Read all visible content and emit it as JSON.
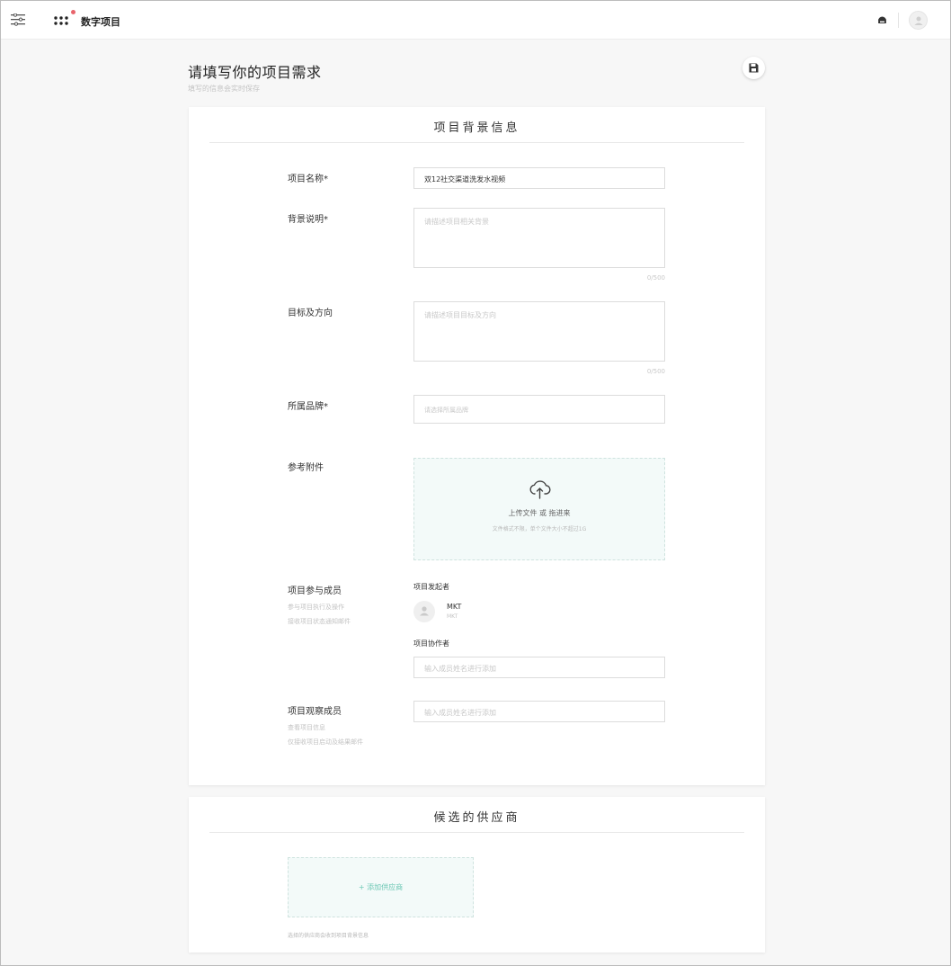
{
  "topbar": {
    "app_name": "数字项目",
    "icons": [
      "menu-icon",
      "apps-grid-icon",
      "notification-dot",
      "helmet-icon",
      "user-avatar-icon"
    ]
  },
  "header": {
    "title": "请填写你的项目需求",
    "subtitle": "填写的信息会实时保存",
    "save_icon": "floppy-disk-icon"
  },
  "background_section": {
    "title": "项目背景信息",
    "project_name": {
      "label": "项目名称*",
      "value": "双12社交渠道洗发水视频"
    },
    "background": {
      "label": "背景说明*",
      "placeholder": "请描述项目相关背景",
      "counter": "0/500"
    },
    "goal": {
      "label": "目标及方向",
      "placeholder": "请描述项目目标及方向",
      "counter": "0/500"
    },
    "brand": {
      "label": "所属品牌*",
      "placeholder": "请选择所属品牌"
    },
    "attachment": {
      "label": "参考附件",
      "upload_text": "上传文件 或 拖进来",
      "upload_hint": "文件格式不限，单个文件大小不超过1G",
      "icon": "cloud-upload-icon"
    },
    "members": {
      "label": "项目参与成员",
      "hint1": "参与项目执行及操作",
      "hint2": "接收项目状态通知邮件",
      "initiator_label": "项目发起者",
      "initiator": {
        "name": "MKT",
        "role": "MKT"
      },
      "collaborator_label": "项目协作者",
      "collaborator_placeholder": "输入成员姓名进行添加"
    },
    "observers": {
      "label": "项目观察成员",
      "hint1": "查看项目信息",
      "hint2": "仅接收项目启动及结果邮件",
      "placeholder": "输入成员姓名进行添加"
    }
  },
  "vendor_section": {
    "title": "候选的供应商",
    "add_label": "+ 添加供应商",
    "hint": "选择的供应商会收到项目背景信息"
  },
  "colors": {
    "accent": "#6dc8b5",
    "upload_bg": "#f3faf9",
    "notification": "#e8646c"
  }
}
